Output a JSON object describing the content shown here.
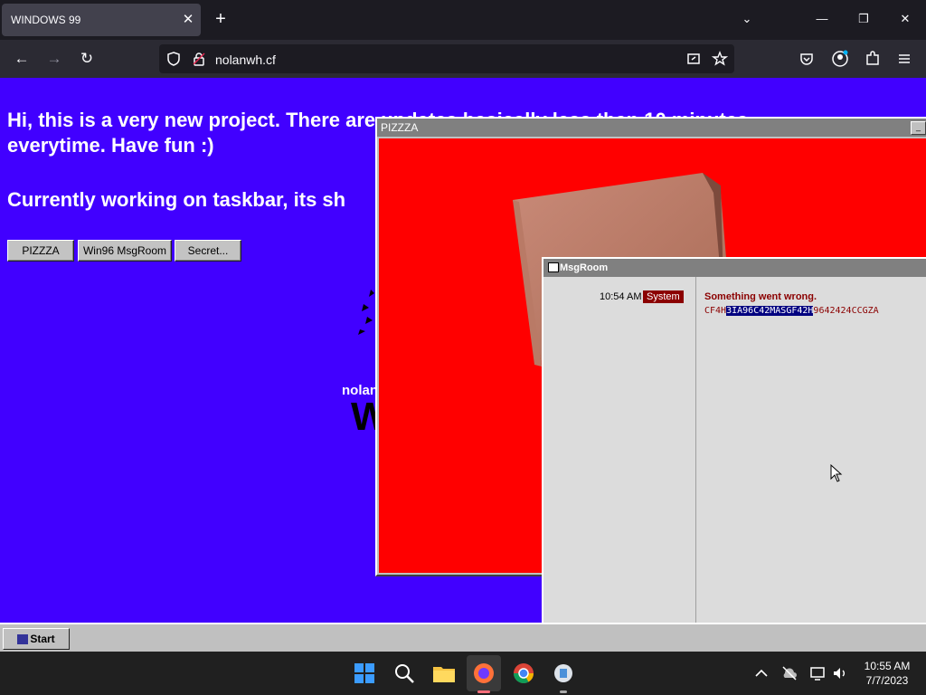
{
  "browser": {
    "tab_title": "WINDOWS 99",
    "tab_close": "✕",
    "new_tab": "+",
    "window_controls": {
      "list": "⌄",
      "minimize": "—",
      "restore": "❐",
      "close": "✕"
    },
    "nav": {
      "back": "←",
      "forward": "→",
      "reload": "↻"
    },
    "url": "nolanwh.cf",
    "icons": [
      "shield-icon",
      "lock-icon",
      "screenshot-icon",
      "star-icon",
      "pocket-icon",
      "account-icon",
      "extensions-icon",
      "menu-icon"
    ]
  },
  "page": {
    "background": "#4100ff",
    "heading1_line1": "Hi, this is a very new project. There are updates basically less than 10 minutes",
    "heading1_line2": "everytime. Have fun :)",
    "heading2": "Currently working on taskbar, its sh",
    "buttons": [
      "PIZZZA",
      "Win96 MsgRoom",
      "Secret..."
    ],
    "logo_small": "nolan",
    "logo_big": "W"
  },
  "pizza_window": {
    "title": "PIZZZA",
    "button": "_",
    "content_color": "#ff0000"
  },
  "msgroom": {
    "title": "MsgRoom",
    "time": "10:54 AM",
    "sender": "System",
    "message_title": "Something went wrong.",
    "code_pre": "CF4H",
    "code_selected": "3IA96C42MASGF42H",
    "code_post": "9642424CCGZA"
  },
  "w99_taskbar": {
    "start_label": "Start"
  },
  "os_taskbar": {
    "apps": [
      "windows-start-icon",
      "search-icon",
      "file-explorer-icon",
      "firefox-icon",
      "chrome-icon",
      "app-icon"
    ],
    "clock_time": "10:55 AM",
    "clock_date": "7/7/2023",
    "tray": [
      "chevron-up-icon",
      "cloud-off-icon",
      "network-icon",
      "volume-icon"
    ]
  }
}
